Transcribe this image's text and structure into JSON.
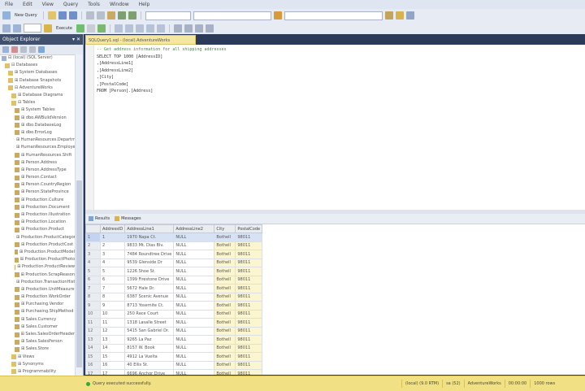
{
  "menubar": {
    "items": [
      "File",
      "Edit",
      "View",
      "Query",
      "Tools",
      "Window",
      "Help"
    ]
  },
  "toolbar": {
    "new_query_label": "New Query",
    "database": "",
    "execute_label": "Execute",
    "search_placeholder": ""
  },
  "object_explorer": {
    "title": "Object Explorer",
    "pin": "▾ ✕",
    "nodes": [
      {
        "label": "⊟ (local) (SQL Server)",
        "indent": 0
      },
      {
        "label": "⊟ Databases",
        "indent": 1
      },
      {
        "label": "⊞ System Databases",
        "indent": 2
      },
      {
        "label": "⊞ Database Snapshots",
        "indent": 2
      },
      {
        "label": "⊟ AdventureWorks",
        "indent": 2
      },
      {
        "label": "⊞ Database Diagrams",
        "indent": 3
      },
      {
        "label": "⊟ Tables",
        "indent": 3
      },
      {
        "label": "⊞ System Tables",
        "indent": 4
      },
      {
        "label": "⊞ dbo.AWBuildVersion",
        "indent": 4
      },
      {
        "label": "⊞ dbo.DatabaseLog",
        "indent": 4
      },
      {
        "label": "⊞ dbo.ErrorLog",
        "indent": 4
      },
      {
        "label": "⊞ HumanResources.Department",
        "indent": 4
      },
      {
        "label": "⊞ HumanResources.Employee",
        "indent": 4
      },
      {
        "label": "⊞ HumanResources.Shift",
        "indent": 4
      },
      {
        "label": "⊞ Person.Address",
        "indent": 4
      },
      {
        "label": "⊞ Person.AddressType",
        "indent": 4
      },
      {
        "label": "⊞ Person.Contact",
        "indent": 4
      },
      {
        "label": "⊞ Person.CountryRegion",
        "indent": 4
      },
      {
        "label": "⊞ Person.StateProvince",
        "indent": 4
      },
      {
        "label": "⊞ Production.Culture",
        "indent": 4
      },
      {
        "label": "⊞ Production.Document",
        "indent": 4
      },
      {
        "label": "⊞ Production.Illustration",
        "indent": 4
      },
      {
        "label": "⊞ Production.Location",
        "indent": 4
      },
      {
        "label": "⊞ Production.Product",
        "indent": 4
      },
      {
        "label": "⊞ Production.ProductCategory",
        "indent": 4
      },
      {
        "label": "⊞ Production.ProductCost",
        "indent": 4
      },
      {
        "label": "⊞ Production.ProductModel",
        "indent": 4
      },
      {
        "label": "⊞ Production.ProductPhoto",
        "indent": 4
      },
      {
        "label": "⊞ Production.ProductReview",
        "indent": 4
      },
      {
        "label": "⊞ Production.ScrapReason",
        "indent": 4
      },
      {
        "label": "⊞ Production.TransactionHistory",
        "indent": 4
      },
      {
        "label": "⊞ Production.UnitMeasure",
        "indent": 4
      },
      {
        "label": "⊞ Production.WorkOrder",
        "indent": 4
      },
      {
        "label": "⊞ Purchasing.Vendor",
        "indent": 4
      },
      {
        "label": "⊞ Purchasing.ShipMethod",
        "indent": 4
      },
      {
        "label": "⊞ Sales.Currency",
        "indent": 4
      },
      {
        "label": "⊞ Sales.Customer",
        "indent": 4
      },
      {
        "label": "⊞ Sales.SalesOrderHeader",
        "indent": 4
      },
      {
        "label": "⊞ Sales.SalesPerson",
        "indent": 4
      },
      {
        "label": "⊞ Sales.Store",
        "indent": 4
      },
      {
        "label": "⊞ Views",
        "indent": 3
      },
      {
        "label": "⊞ Synonyms",
        "indent": 3
      },
      {
        "label": "⊞ Programmability",
        "indent": 3
      },
      {
        "label": "⊞ Security",
        "indent": 3
      },
      {
        "label": "⊞ Server Objects",
        "indent": 1
      },
      {
        "label": "⊞ Replication",
        "indent": 1
      },
      {
        "label": "⊞ Management",
        "indent": 1
      }
    ]
  },
  "document": {
    "tab_label": "SQLQuery1.sql - (local).AdventureWorks",
    "lines": [
      {
        "cls": "cm",
        "text": "-- Get address information for all shipping addresses"
      },
      {
        "cls": "",
        "text": "SELECT TOP 1000 [AddressID]"
      },
      {
        "cls": "",
        "text": "      ,[AddressLine1]"
      },
      {
        "cls": "",
        "text": "      ,[AddressLine2]"
      },
      {
        "cls": "",
        "text": "      ,[City]"
      },
      {
        "cls": "",
        "text": "      ,[PostalCode]"
      },
      {
        "cls": "",
        "text": "  FROM [Person].[Address]"
      }
    ]
  },
  "results": {
    "tabs": [
      "Results",
      "Messages"
    ],
    "columns": [
      "",
      "AddressID",
      "AddressLine1",
      "AddressLine2",
      "City",
      "PostalCode"
    ],
    "rows": [
      [
        "1",
        "1",
        "1970 Napa Ct.",
        "NULL",
        "Bothell",
        "98011"
      ],
      [
        "2",
        "2",
        "9833 Mt. Dias Blv.",
        "NULL",
        "Bothell",
        "98011"
      ],
      [
        "3",
        "3",
        "7484 Roundtree Drive",
        "NULL",
        "Bothell",
        "98011"
      ],
      [
        "4",
        "4",
        "9539 Glenside Dr",
        "NULL",
        "Bothell",
        "98011"
      ],
      [
        "5",
        "5",
        "1226 Shoe St.",
        "NULL",
        "Bothell",
        "98011"
      ],
      [
        "6",
        "6",
        "1399 Firestone Drive",
        "NULL",
        "Bothell",
        "98011"
      ],
      [
        "7",
        "7",
        "5672 Hale Dr.",
        "NULL",
        "Bothell",
        "98011"
      ],
      [
        "8",
        "8",
        "6387 Scenic Avenue",
        "NULL",
        "Bothell",
        "98011"
      ],
      [
        "9",
        "9",
        "8713 Yosemite Ct.",
        "NULL",
        "Bothell",
        "98011"
      ],
      [
        "10",
        "10",
        "250 Race Court",
        "NULL",
        "Bothell",
        "98011"
      ],
      [
        "11",
        "11",
        "1318 Lasalle Street",
        "NULL",
        "Bothell",
        "98011"
      ],
      [
        "12",
        "12",
        "5415 San Gabriel Dr.",
        "NULL",
        "Bothell",
        "98011"
      ],
      [
        "13",
        "13",
        "9265 La Paz",
        "NULL",
        "Bothell",
        "98011"
      ],
      [
        "14",
        "14",
        "8157 W. Book",
        "NULL",
        "Bothell",
        "98011"
      ],
      [
        "15",
        "15",
        "4912 La Vuelta",
        "NULL",
        "Bothell",
        "98011"
      ],
      [
        "16",
        "16",
        "40 Ellis St.",
        "NULL",
        "Bothell",
        "98011"
      ],
      [
        "17",
        "17",
        "6696 Anchor Drive",
        "NULL",
        "Bothell",
        "98011"
      ],
      [
        "18",
        "18",
        "1873 Lion Circle",
        "NULL",
        "Bothell",
        "98011"
      ]
    ]
  },
  "status": {
    "message": "Query executed successfully.",
    "server": "(local) (9.0 RTM)",
    "user": "sa (52)",
    "database": "AdventureWorks",
    "elapsed": "00:00:00",
    "rows": "1000 rows"
  }
}
